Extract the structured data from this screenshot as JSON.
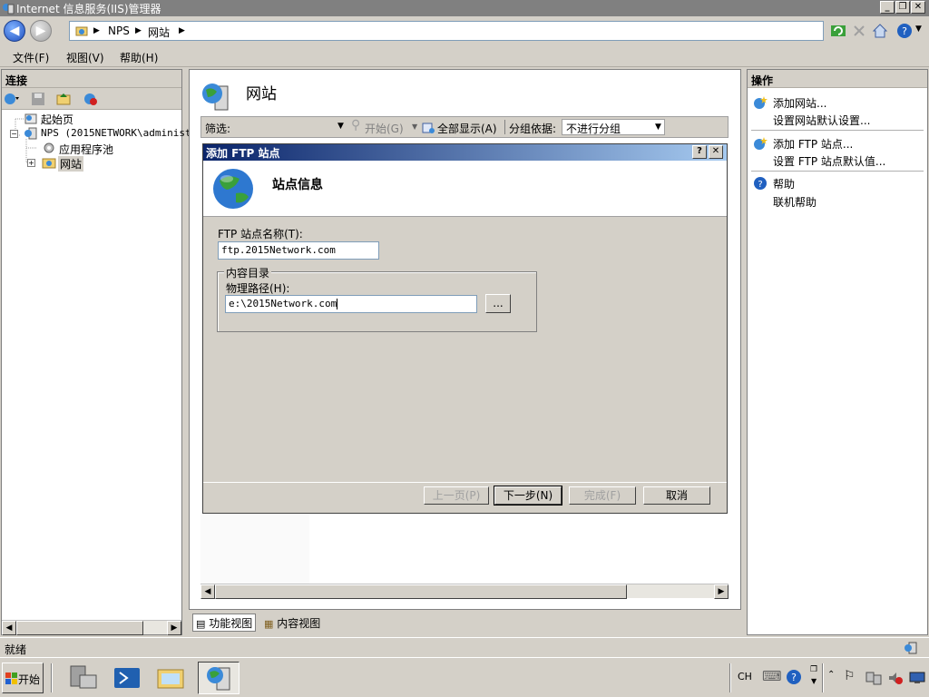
{
  "window": {
    "title": "Internet 信息服务(IIS)管理器"
  },
  "address": {
    "crumbs": [
      "NPS",
      "网站"
    ]
  },
  "menu": {
    "file": "文件(F)",
    "view": "视图(V)",
    "help": "帮助(H)"
  },
  "connections": {
    "header": "连接",
    "tree": {
      "start_page": "起始页",
      "server": "NPS (2015NETWORK\\administr",
      "app_pools": "应用程序池",
      "sites": "网站"
    }
  },
  "center": {
    "title": "网站",
    "filter_label": "筛选:",
    "start_label": "开始(G)",
    "show_all_label": "全部显示(A)",
    "group_by_label": "分组依据:",
    "group_by_value": "不进行分组"
  },
  "dialog": {
    "title": "添加 FTP 站点",
    "header": "站点信息",
    "site_name_label": "FTP 站点名称(T):",
    "site_name_value": "ftp.2015Network.com",
    "content_dir_legend": "内容目录",
    "physical_path_label": "物理路径(H):",
    "physical_path_value": "e:\\2015Network.com",
    "browse_label": "...",
    "help_btn": "?",
    "close_btn": "✕",
    "buttons": {
      "prev": "上一页(P)",
      "next": "下一步(N)",
      "finish": "完成(F)",
      "cancel": "取消"
    }
  },
  "actions": {
    "header": "操作",
    "add_site": "添加网站...",
    "site_defaults": "设置网站默认设置...",
    "add_ftp": "添加 FTP 站点...",
    "ftp_defaults": "设置 FTP 站点默认值...",
    "help": "帮助",
    "online_help": "联机帮助"
  },
  "tabs": {
    "features": "功能视图",
    "content": "内容视图"
  },
  "status": {
    "text": "就绪"
  },
  "taskbar": {
    "start": "开始",
    "lang": "CH"
  },
  "colors": {
    "dialog_title_start": "#0a246a",
    "dialog_title_end": "#a6caf0",
    "chrome": "#d4d0c8"
  }
}
